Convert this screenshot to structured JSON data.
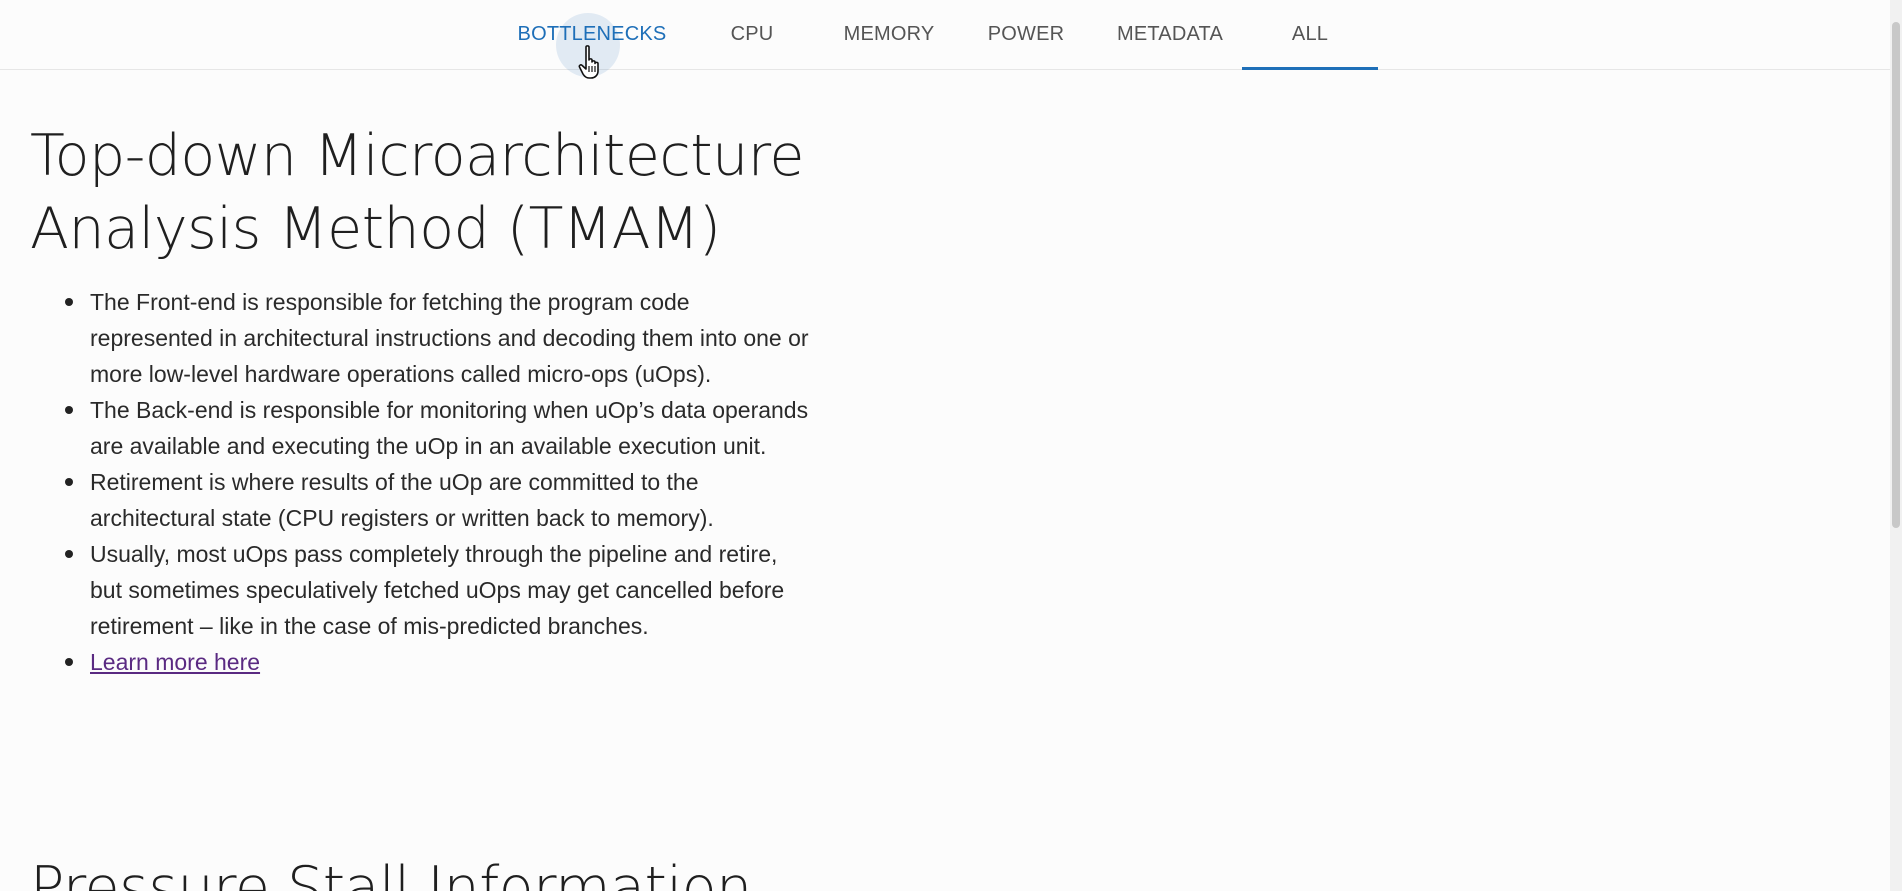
{
  "tabs": [
    {
      "label": "BOTTLENECKS",
      "state": "hover"
    },
    {
      "label": "CPU",
      "state": "normal"
    },
    {
      "label": "MEMORY",
      "state": "normal"
    },
    {
      "label": "POWER",
      "state": "normal"
    },
    {
      "label": "METADATA",
      "state": "normal"
    },
    {
      "label": "ALL",
      "state": "selected"
    }
  ],
  "section": {
    "title": "Top-down Microarchitecture Analysis Method (TMAM)",
    "bullets": [
      "The Front-end is responsible for fetching the program code represented in architectural instructions and decoding them into one or more low-level hardware operations called micro-ops (uOps).",
      "The Back-end is responsible for monitoring when uOp’s data operands are available and executing the uOp in an available execution unit.",
      "Retirement is where results of the uOp are committed to the architectural state (CPU registers or written back to memory).",
      "Usually, most uOps pass completely through the pipeline and retire, but sometimes speculatively fetched uOps may get cancelled before retirement – like in the case of mis-predicted branches."
    ],
    "link_label": "Learn more here"
  },
  "next_section": {
    "title": "Pressure Stall Information"
  },
  "colors": {
    "accent": "#1e6fb8",
    "link_visited": "#5a2a82",
    "text": "#1f1f1f"
  }
}
